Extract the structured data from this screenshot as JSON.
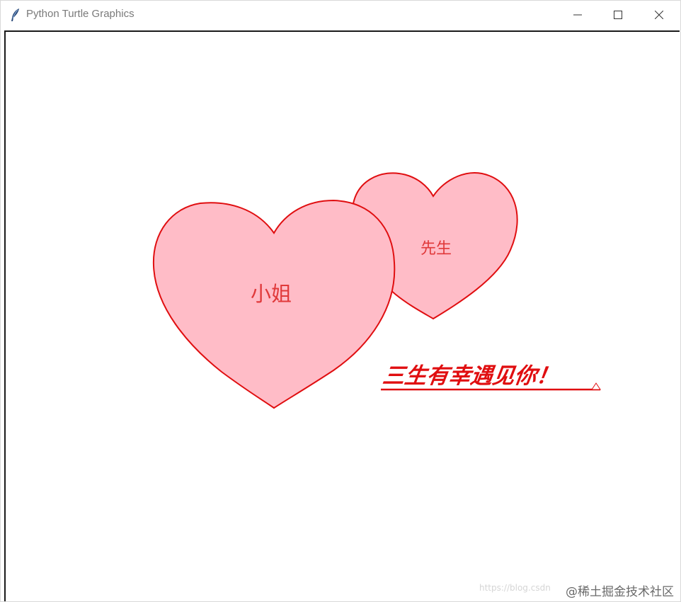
{
  "window": {
    "title": "Python Turtle Graphics",
    "icon": "feather-icon"
  },
  "controls": {
    "minimize_icon": "minimize-icon",
    "maximize_icon": "maximize-icon",
    "close_icon": "close-icon"
  },
  "canvas": {
    "big_heart_label": "小姐",
    "small_heart_label": "先生",
    "message": "三生有幸遇见你！",
    "heart_fill": "#ffbcc7",
    "heart_stroke": "#e00e10",
    "text_color": "#e0393a"
  },
  "watermark": {
    "blog_text": "https://blog.csdn",
    "site_text": "@稀土掘金技术社区"
  }
}
